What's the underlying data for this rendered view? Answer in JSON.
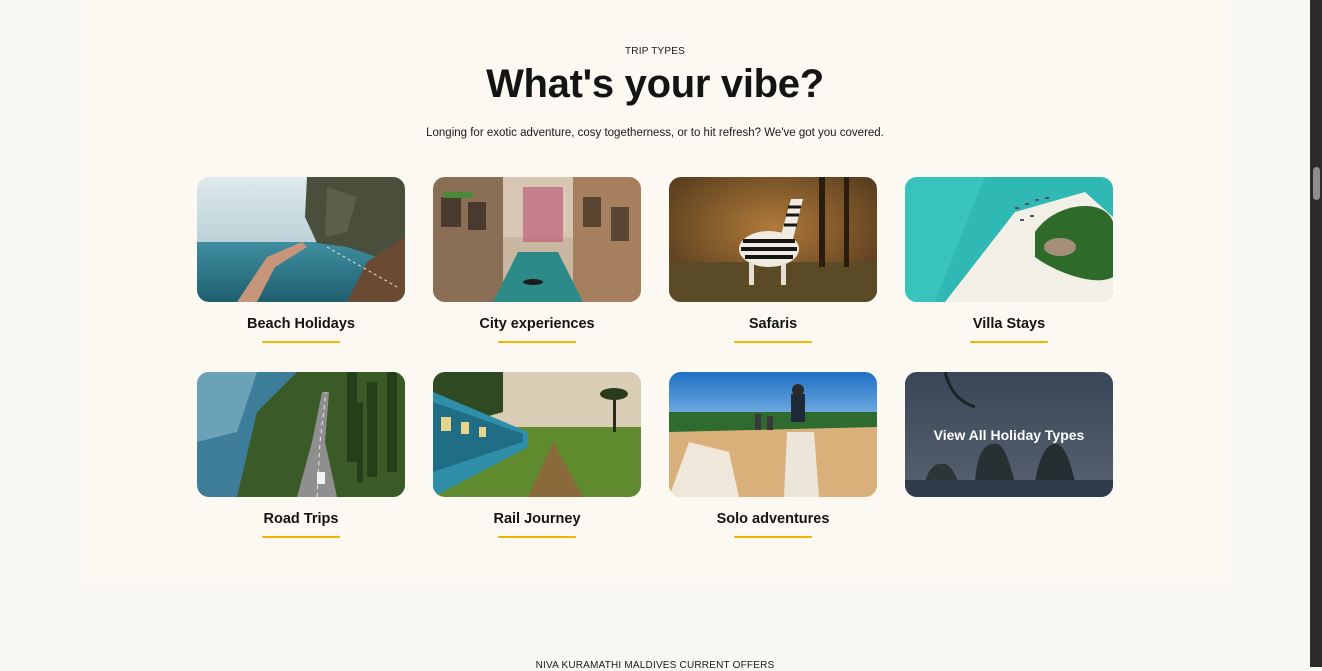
{
  "section": {
    "eyebrow": "TRIP TYPES",
    "title": "What's your vibe?",
    "subtitle": "Longing for exotic adventure, cosy togetherness, or to hit refresh? We've got you covered."
  },
  "trip_types": [
    {
      "label": "Beach Holidays",
      "image_icon": "beach-diving-photo"
    },
    {
      "label": "City experiences",
      "image_icon": "venice-canal-photo"
    },
    {
      "label": "Safaris",
      "image_icon": "zebra-photo"
    },
    {
      "label": "Villa Stays",
      "image_icon": "island-beach-aerial-photo"
    },
    {
      "label": "Road Trips",
      "image_icon": "coastal-road-photo"
    },
    {
      "label": "Rail Journey",
      "image_icon": "train-tea-plantation-photo"
    },
    {
      "label": "Solo adventures",
      "image_icon": "horse-riding-photo"
    }
  ],
  "view_all": {
    "label": "View All Holiday Types"
  },
  "next_section": {
    "eyebrow": "NIVA KURAMATHI MALDIVES CURRENT OFFERS"
  },
  "colors": {
    "accent": "#f4b400",
    "panel_bg": "#fcf8f2",
    "page_bg": "#f9f7f3"
  }
}
